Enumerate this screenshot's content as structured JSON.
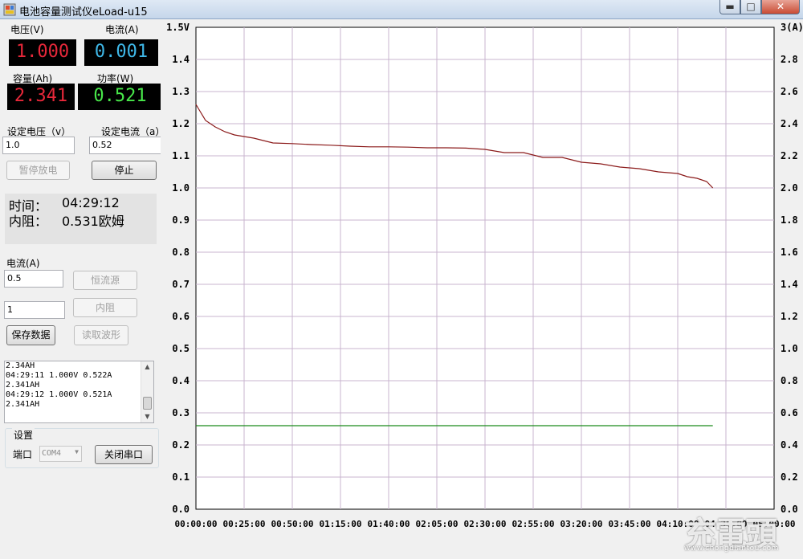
{
  "window": {
    "title": "电池容量测试仪eLoad-u15"
  },
  "meters": {
    "voltage_label": "电压(V)",
    "voltage_value": "1.000",
    "current_label": "电流(A)",
    "current_value": "0.001",
    "capacity_label": "容量(Ah)",
    "capacity_value": "2.341",
    "power_label": "功率(W)",
    "power_value": "0.521"
  },
  "settings": {
    "set_voltage_label": "设定电压（v）",
    "set_voltage_value": "1.0",
    "set_current_label": "设定电流（a）",
    "set_current_value": "0.52",
    "pause_button": "暂停放电",
    "stop_button": "停止"
  },
  "info": {
    "time_label": "时间：",
    "time_value": "04:29:12",
    "resistance_label": "内阻：",
    "resistance_value": "0.531欧姆"
  },
  "mode": {
    "current_label": "电流(A)",
    "current_value": "0.5",
    "constant_current_button": "恒流源",
    "second_value": "1",
    "internal_resistance_button": "内阻",
    "save_button": "保存数据",
    "read_waveform_button": "读取波形"
  },
  "log": {
    "lines": [
      "2.34AH",
      "04:29:11 1.000V 0.522A",
      "2.341AH",
      "04:29:12 1.000V 0.521A",
      "2.341AH"
    ]
  },
  "port": {
    "group_label": "设置",
    "port_label": "端口",
    "port_value": "COM4",
    "close_port_button": "关闭串口"
  },
  "icons": {
    "app_icon": "app-icon",
    "minimize": "minimize-icon",
    "maximize": "maximize-icon",
    "close": "close-icon"
  },
  "colors": {
    "voltage_line": "#8b1a1a",
    "current_line": "#1a8a1a",
    "grid": "#c9b4cf",
    "meter_red": "#e8283a",
    "meter_cyan": "#3fb8e8",
    "meter_green": "#48e84a"
  },
  "watermark": {
    "logo": "充電頭",
    "url": "www.chongdiantou.com"
  },
  "chart_data": {
    "type": "line",
    "left_axis": {
      "ylim": [
        0,
        1.5
      ],
      "ticks": [
        "0.0",
        "0.1",
        "0.2",
        "0.3",
        "0.4",
        "0.5",
        "0.6",
        "0.7",
        "0.8",
        "0.9",
        "1.0",
        "1.1",
        "1.2",
        "1.3",
        "1.4",
        "1.5V"
      ]
    },
    "right_axis": {
      "ylim": [
        0,
        3
      ],
      "ticks": [
        "0.0",
        "0.2",
        "0.4",
        "0.6",
        "0.8",
        "1.0",
        "1.2",
        "1.4",
        "1.6",
        "1.8",
        "2.0",
        "2.2",
        "2.4",
        "2.6",
        "2.8",
        "3(A)"
      ]
    },
    "x_axis": {
      "range_minutes": [
        0,
        300
      ],
      "ticks": [
        "00:00:00",
        "00:25:00",
        "00:50:00",
        "01:15:00",
        "01:40:00",
        "02:05:00",
        "02:30:00",
        "02:55:00",
        "03:20:00",
        "03:45:00",
        "04:10:00",
        "04:35:00",
        "05:00:00"
      ]
    },
    "grid": true,
    "series": [
      {
        "axis": "left",
        "x_minutes": [
          0,
          2,
          5,
          10,
          15,
          20,
          25,
          30,
          40,
          50,
          60,
          70,
          80,
          90,
          100,
          110,
          120,
          130,
          140,
          150,
          160,
          170,
          180,
          190,
          200,
          210,
          220,
          230,
          240,
          250,
          255,
          260,
          265,
          268.2
        ],
        "values": [
          1.26,
          1.24,
          1.21,
          1.19,
          1.175,
          1.165,
          1.16,
          1.155,
          1.14,
          1.138,
          1.135,
          1.133,
          1.13,
          1.128,
          1.128,
          1.127,
          1.125,
          1.125,
          1.124,
          1.12,
          1.11,
          1.11,
          1.095,
          1.095,
          1.08,
          1.075,
          1.065,
          1.06,
          1.05,
          1.045,
          1.035,
          1.03,
          1.02,
          1.0
        ]
      },
      {
        "axis": "right",
        "x_minutes": [
          0,
          268.2
        ],
        "values": [
          0.52,
          0.52
        ]
      }
    ]
  }
}
